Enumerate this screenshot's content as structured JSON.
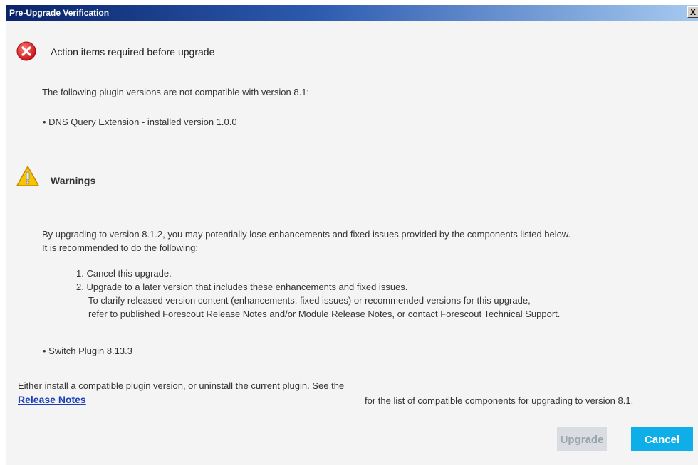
{
  "window": {
    "title": "Pre-Upgrade Verification",
    "close_label": "X"
  },
  "icons": {
    "error": "error-x-icon",
    "warning": "warning-triangle-icon"
  },
  "colors": {
    "error_red": "#e0282a",
    "warning_yellow": "#f7c500",
    "primary_button": "#0eaee8",
    "link": "#1a3db8"
  },
  "action_items": {
    "heading": "Action items required before upgrade",
    "intro": "The following plugin versions are not compatible with version 8.1:",
    "bullets": [
      "• DNS Query Extension - installed version 1.0.0"
    ]
  },
  "warnings": {
    "heading": "Warnings",
    "paragraph_line1": "By upgrading to version 8.1.2, you may potentially lose enhancements and fixed issues provided by the components listed below.",
    "paragraph_line2": "It is recommended to do the following:",
    "steps": [
      "1. Cancel this upgrade.",
      "2. Upgrade to a later version that includes these enhancements and fixed issues."
    ],
    "step2_detail_line1": "To clarify released version content (enhancements, fixed issues) or recommended versions for this upgrade,",
    "step2_detail_line2": "refer to published Forescout Release Notes and/or Module Release Notes, or contact Forescout Technical Support.",
    "bullets": [
      "• Switch Plugin 8.13.3"
    ]
  },
  "footer": {
    "line1": "Either install a compatible plugin version, or uninstall the current plugin. See the",
    "link_label": "Release Notes",
    "line2_suffix": "for the list of compatible components for upgrading to version 8.1."
  },
  "buttons": {
    "upgrade": "Upgrade",
    "cancel": "Cancel"
  }
}
